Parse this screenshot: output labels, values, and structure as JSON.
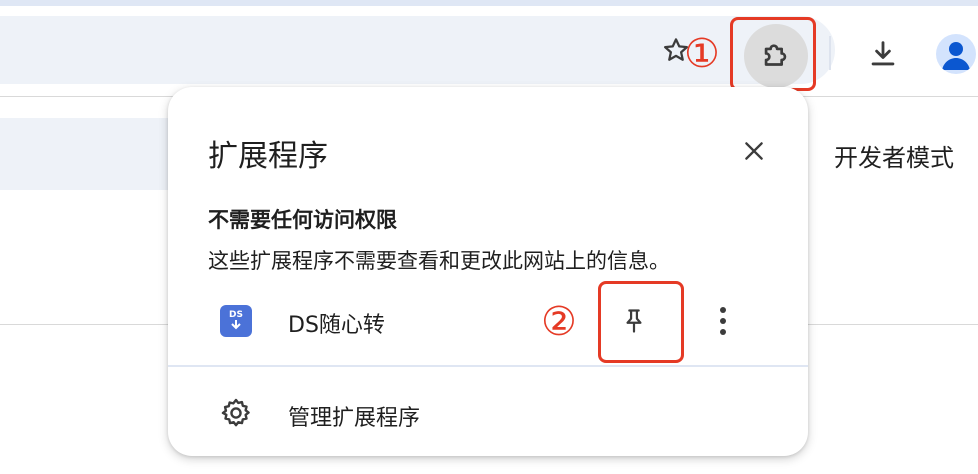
{
  "toolbar": {
    "bookmark_icon": "star-outline-icon",
    "extensions_icon": "puzzle-icon",
    "download_icon": "download-icon",
    "avatar_icon": "person-icon",
    "accent": "#1a73e8"
  },
  "annotations": {
    "marker_1": "①",
    "marker_2": "②",
    "color": "#e53a25"
  },
  "page": {
    "dev_mode_label": "开发者模式"
  },
  "popup": {
    "title": "扩展程序",
    "close_icon": "close-icon",
    "section_title": "不需要任何访问权限",
    "section_desc": "这些扩展程序不需要查看和更改此网站上的信息。",
    "extensions": [
      {
        "name": "DS随心转",
        "icon_text": "DS",
        "pin_icon": "pin-icon",
        "more_icon": "more-vert-icon"
      }
    ],
    "manage_label": "管理扩展程序",
    "manage_icon": "gear-icon"
  }
}
